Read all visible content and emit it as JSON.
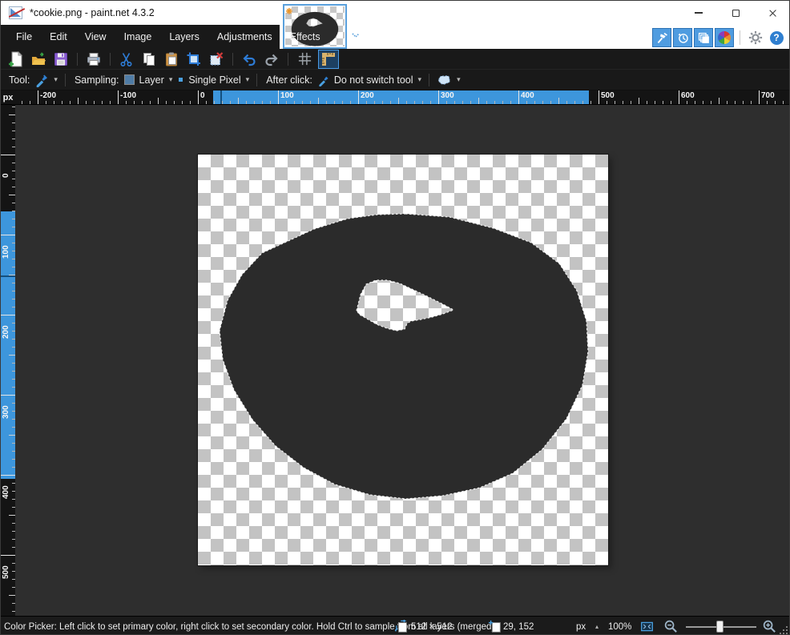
{
  "window": {
    "title": "*cookie.png - paint.net 4.3.2",
    "controls": [
      "minimize",
      "maximize",
      "close"
    ]
  },
  "menu": {
    "items": [
      "File",
      "Edit",
      "View",
      "Image",
      "Layers",
      "Adjustments",
      "Effects"
    ]
  },
  "toolbar": {
    "buttons": [
      "new",
      "open",
      "save",
      "print",
      "cut",
      "copy",
      "paste",
      "crop-to-selection",
      "deselect",
      "undo",
      "redo",
      "grid-toggle",
      "rulers-toggle"
    ],
    "active_button": "rulers-toggle"
  },
  "tool_options": {
    "tool_label": "Tool:",
    "tool_icon": "color-picker",
    "sampling_label": "Sampling:",
    "sampling_value": "Layer",
    "pixel_mode_value": "Single Pixel",
    "after_click_label": "After click:",
    "after_click_value": "Do not switch tool",
    "selection_mode_icon": "selection-clipping",
    "dropdown_arrow": "▾"
  },
  "utility_buttons": [
    "tools",
    "history",
    "layers",
    "colors",
    "settings",
    "help"
  ],
  "help_glyph": "?",
  "rulers": {
    "unit_label": "px",
    "h_labels": [
      "-200",
      "-100",
      "0",
      "100",
      "200",
      "300",
      "400",
      "500",
      "600",
      "700"
    ],
    "v_labels": [
      "0",
      "100",
      "200",
      "300",
      "400",
      "500"
    ]
  },
  "status_bar": {
    "hint": "Color Picker: Left click to set primary color, right click to set secondary color. Hold Ctrl to sample from all layers (merged).",
    "image_size": "512 × 512",
    "cursor_position": "29, 152",
    "unit": "px",
    "unit_caret": "▴",
    "zoom": "100%"
  },
  "colors": {
    "accent_blue": "#3d96dc",
    "ruler_highlight": "#3d96dc",
    "ruler_marker": "#14507f",
    "checker_gray": "#c3c3c3",
    "shape_fill": "#2b2b2b",
    "titlebar_bg": "#ffffff",
    "bar_bg": "#191919",
    "workspace_bg": "#2e2e2e",
    "toggle_button_bg": "#4f9ce0"
  }
}
